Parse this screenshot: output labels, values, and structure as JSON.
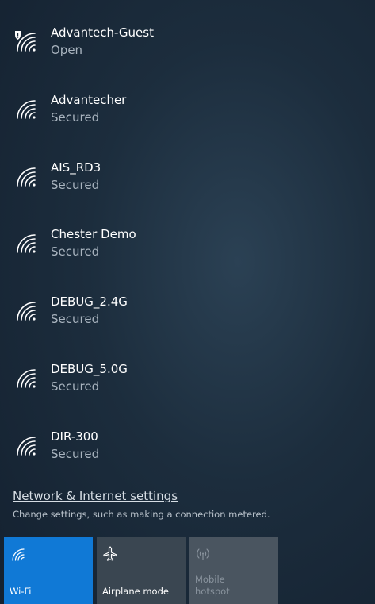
{
  "networks": [
    {
      "name": "Advantech-Guest",
      "status": "Open",
      "icon": "wifi-shield-icon"
    },
    {
      "name": "Advantecher",
      "status": "Secured",
      "icon": "wifi-icon"
    },
    {
      "name": "AIS_RD3",
      "status": "Secured",
      "icon": "wifi-icon"
    },
    {
      "name": "Chester Demo",
      "status": "Secured",
      "icon": "wifi-icon"
    },
    {
      "name": "DEBUG_2.4G",
      "status": "Secured",
      "icon": "wifi-icon"
    },
    {
      "name": "DEBUG_5.0G",
      "status": "Secured",
      "icon": "wifi-icon"
    },
    {
      "name": "DIR-300",
      "status": "Secured",
      "icon": "wifi-icon"
    }
  ],
  "settings": {
    "link_label": "Network & Internet settings",
    "description": "Change settings, such as making a connection metered."
  },
  "quick_actions": [
    {
      "label": "Wi-Fi",
      "icon": "wifi-icon",
      "state": "on"
    },
    {
      "label": "Airplane mode",
      "icon": "airplane-icon",
      "state": "off"
    },
    {
      "label": "Mobile hotspot",
      "icon": "hotspot-icon",
      "state": "disabled"
    }
  ],
  "colors": {
    "accent": "#1079d6",
    "background": "#1c2d3d",
    "secondary_text": "#a9b4bf"
  }
}
